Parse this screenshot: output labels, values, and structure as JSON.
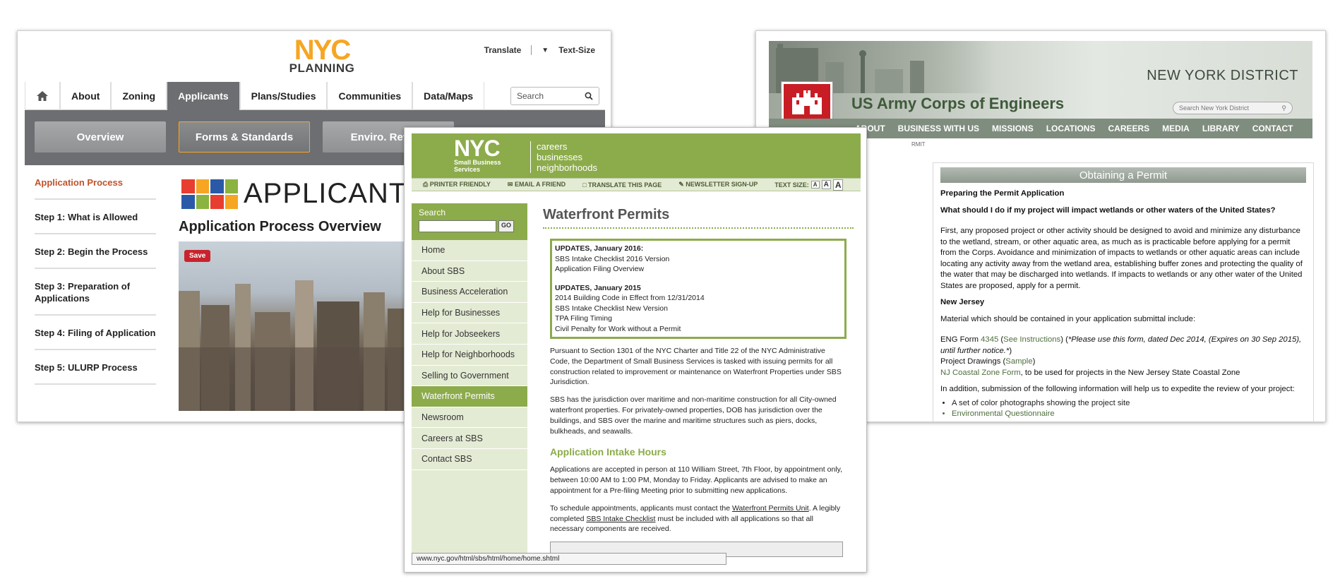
{
  "planning": {
    "logo": {
      "nyc": "NYC",
      "planning": "PLANNING"
    },
    "top_links": {
      "translate": "Translate",
      "translate_arrow": "▼",
      "text_size": "Text-Size"
    },
    "nav": [
      "About",
      "Zoning",
      "Applicants",
      "Plans/Studies",
      "Communities",
      "Data/Maps"
    ],
    "nav_active": "Applicants",
    "search_placeholder": "Search",
    "sub_buttons": [
      "Overview",
      "Forms & Standards",
      "Enviro. Review"
    ],
    "side": [
      "Application Process",
      "Step 1: What is Allowed",
      "Step 2: Begin the Process",
      "Step 3: Preparation of Applications",
      "Step 4: Filing of Application",
      "Step 5: ULURP Process"
    ],
    "banner_title": "APPLICANT PORTAL",
    "heading": "Application Process Overview",
    "save": "Save",
    "block_colors": [
      "#e83e2f",
      "#f6a623",
      "#2a5aa7",
      "#8bb33f",
      "#2a5aa7",
      "#8bb33f",
      "#e83e2f",
      "#f6a623"
    ]
  },
  "army": {
    "district": "NEW YORK DISTRICT",
    "title": "US Army Corps of Engineers",
    "search_placeholder": "Search New York District",
    "nav": [
      "ABOUT",
      "BUSINESS WITH US",
      "MISSIONS",
      "LOCATIONS",
      "CAREERS",
      "MEDIA",
      "LIBRARY",
      "CONTACT"
    ],
    "breadcrumb": "RMIT",
    "box_title": "Obtaining a Permit",
    "h_prep": "Preparing the Permit Application",
    "q": "What should I do if my project will impact wetlands or other waters of the United States?",
    "p1": "First, any proposed project or other activity should be designed to avoid and minimize any disturbance to the wetland, stream, or other aquatic area, as much as is practicable before applying for a permit from the Corps. Avoidance and minimization of impacts to wetlands or other aquatic areas can include locating any activity away from the wetland area, establishing buffer zones and protecting the quality of the water that may be discharged into wetlands. If impacts to wetlands or any other water of the United States are proposed, apply for a permit.",
    "nj": "New Jersey",
    "material": "Material which should be contained in your application submittal include:",
    "eng_a": "ENG Form ",
    "eng_link": "4345",
    "eng_b": " (",
    "eng_instr": "See Instructions",
    "eng_c": ") (",
    "eng_note": "*Please use this form, dated Dec 2014, (Expires on 30 Sep 2015), until further notice.*",
    "eng_d": ")",
    "drawings_a": "Project Drawings (",
    "drawings_link": "Sample",
    "drawings_b": ")",
    "czf_link": "NJ Coastal Zone Form",
    "czf_rest": ", to be used for projects in the New Jersey State Coastal Zone",
    "addition": "In addition, submission of the following information will help us to expedite the review of your project:",
    "bullets": [
      "A set of color photographs showing the project site",
      "Environmental Questionnaire"
    ],
    "castle_icon": "castle-icon"
  },
  "sbs": {
    "logo_nyc": "NYC",
    "logo_sub1": "Small Business",
    "logo_sub2": "Services",
    "tags": [
      "careers",
      "businesses",
      "neighborhoods"
    ],
    "util": [
      "PRINTER FRIENDLY",
      "EMAIL A FRIEND",
      "TRANSLATE THIS PAGE",
      "NEWSLETTER SIGN-UP"
    ],
    "text_size": "TEXT SIZE:",
    "search_label": "Search",
    "go": "GO",
    "nav": [
      "Home",
      "About SBS",
      "Business Acceleration",
      "Help for Businesses",
      "Help for Jobseekers",
      "Help for Neighborhoods",
      "Selling to Government",
      "Waterfront Permits",
      "Newsroom",
      "Careers at SBS",
      "Contact SBS"
    ],
    "nav_active": "Waterfront Permits",
    "title": "Waterfront Permits",
    "upd1_title": "UPDATES, January 2016:",
    "upd1_lines": [
      "SBS Intake Checklist 2016 Version",
      "Application Filing Overview"
    ],
    "upd2_title": "UPDATES, January 2015",
    "upd2_lines": [
      "2014 Building Code in Effect from 12/31/2014",
      "SBS Intake Checklist New Version",
      "TPA Filing Timing",
      "Civil Penalty for Work without a Permit"
    ],
    "p1": "Pursuant to Section 1301 of the NYC Charter and Title 22 of the NYC Administrative Code, the Department of Small Business Services is tasked with issuing permits for all construction related to improvement or maintenance on Waterfront Properties under SBS Jurisdiction.",
    "p2": "SBS has the jurisdiction over maritime and non-maritime construction for all City-owned waterfront properties. For privately-owned properties, DOB has jurisdiction over the buildings, and SBS over the marine and maritime structures such as piers, docks, bulkheads, and seawalls.",
    "h_intake": "Application Intake Hours",
    "p3": "Applications are accepted in person at 110 William Street, 7th Floor, by appointment only, between 10:00 AM to 1:00 PM, Monday to Friday. Applicants are advised to make an appointment for a Pre-filing Meeting prior to submitting new applications.",
    "p4_a": "To schedule appointments, applicants must contact the ",
    "p4_link1": "Waterfront Permits Unit",
    "p4_b": ". A legibly completed ",
    "p4_link2": "SBS Intake Checklist",
    "p4_c": " must be included with all applications so that all necessary components are received.",
    "status_url": "www.nyc.gov/html/sbs/html/home/home.shtml"
  }
}
